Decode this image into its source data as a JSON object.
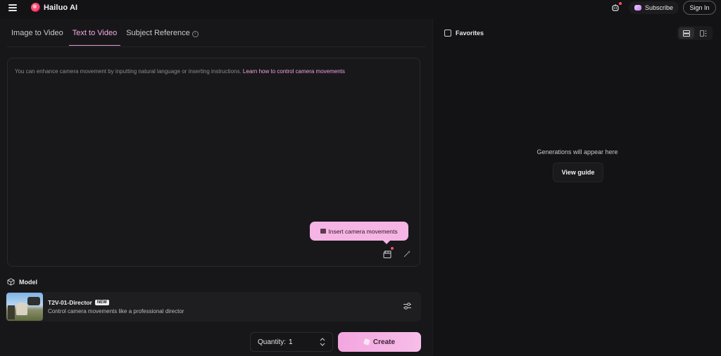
{
  "app": {
    "name": "Hailuo AI",
    "icons": {
      "menu": "hamburger-icon",
      "logo": "hailuo-logo-icon",
      "notifications": "robot-icon",
      "subscribe": "gem-icon"
    }
  },
  "header": {
    "subscribe_label": "Subscribe",
    "signin_label": "Sign In"
  },
  "tabs": [
    {
      "label": "Image to Video",
      "active": false
    },
    {
      "label": "Text to Video",
      "active": true
    },
    {
      "label": "Subject Reference",
      "active": false,
      "info_icon": "info-icon"
    }
  ],
  "prompt": {
    "placeholder": "You can enhance camera movement by inputting natural language or inserting instructions.",
    "link_text": "Learn how to control camera movements",
    "tooltip": "Insert camera movements",
    "icons": [
      "clapperboard-icon",
      "magic-wand-icon"
    ]
  },
  "model": {
    "section_label": "Model",
    "name": "T2V-01-Director",
    "badge": "NEW",
    "description": "Control camera movements like a professional director",
    "settings_icon": "sliders-icon"
  },
  "footer": {
    "quantity_label": "Quantity:",
    "quantity_value": "1",
    "create_label": "Create"
  },
  "results": {
    "favorites_label": "Favorites",
    "empty_text": "Generations will appear here",
    "view_guide_label": "View guide",
    "view_icons": [
      "single-view-icon",
      "split-view-icon"
    ]
  },
  "colors": {
    "accent": "#f3a6df",
    "background": "#131315",
    "panel": "#17171a",
    "notification_dot": "#ff4d6d"
  }
}
